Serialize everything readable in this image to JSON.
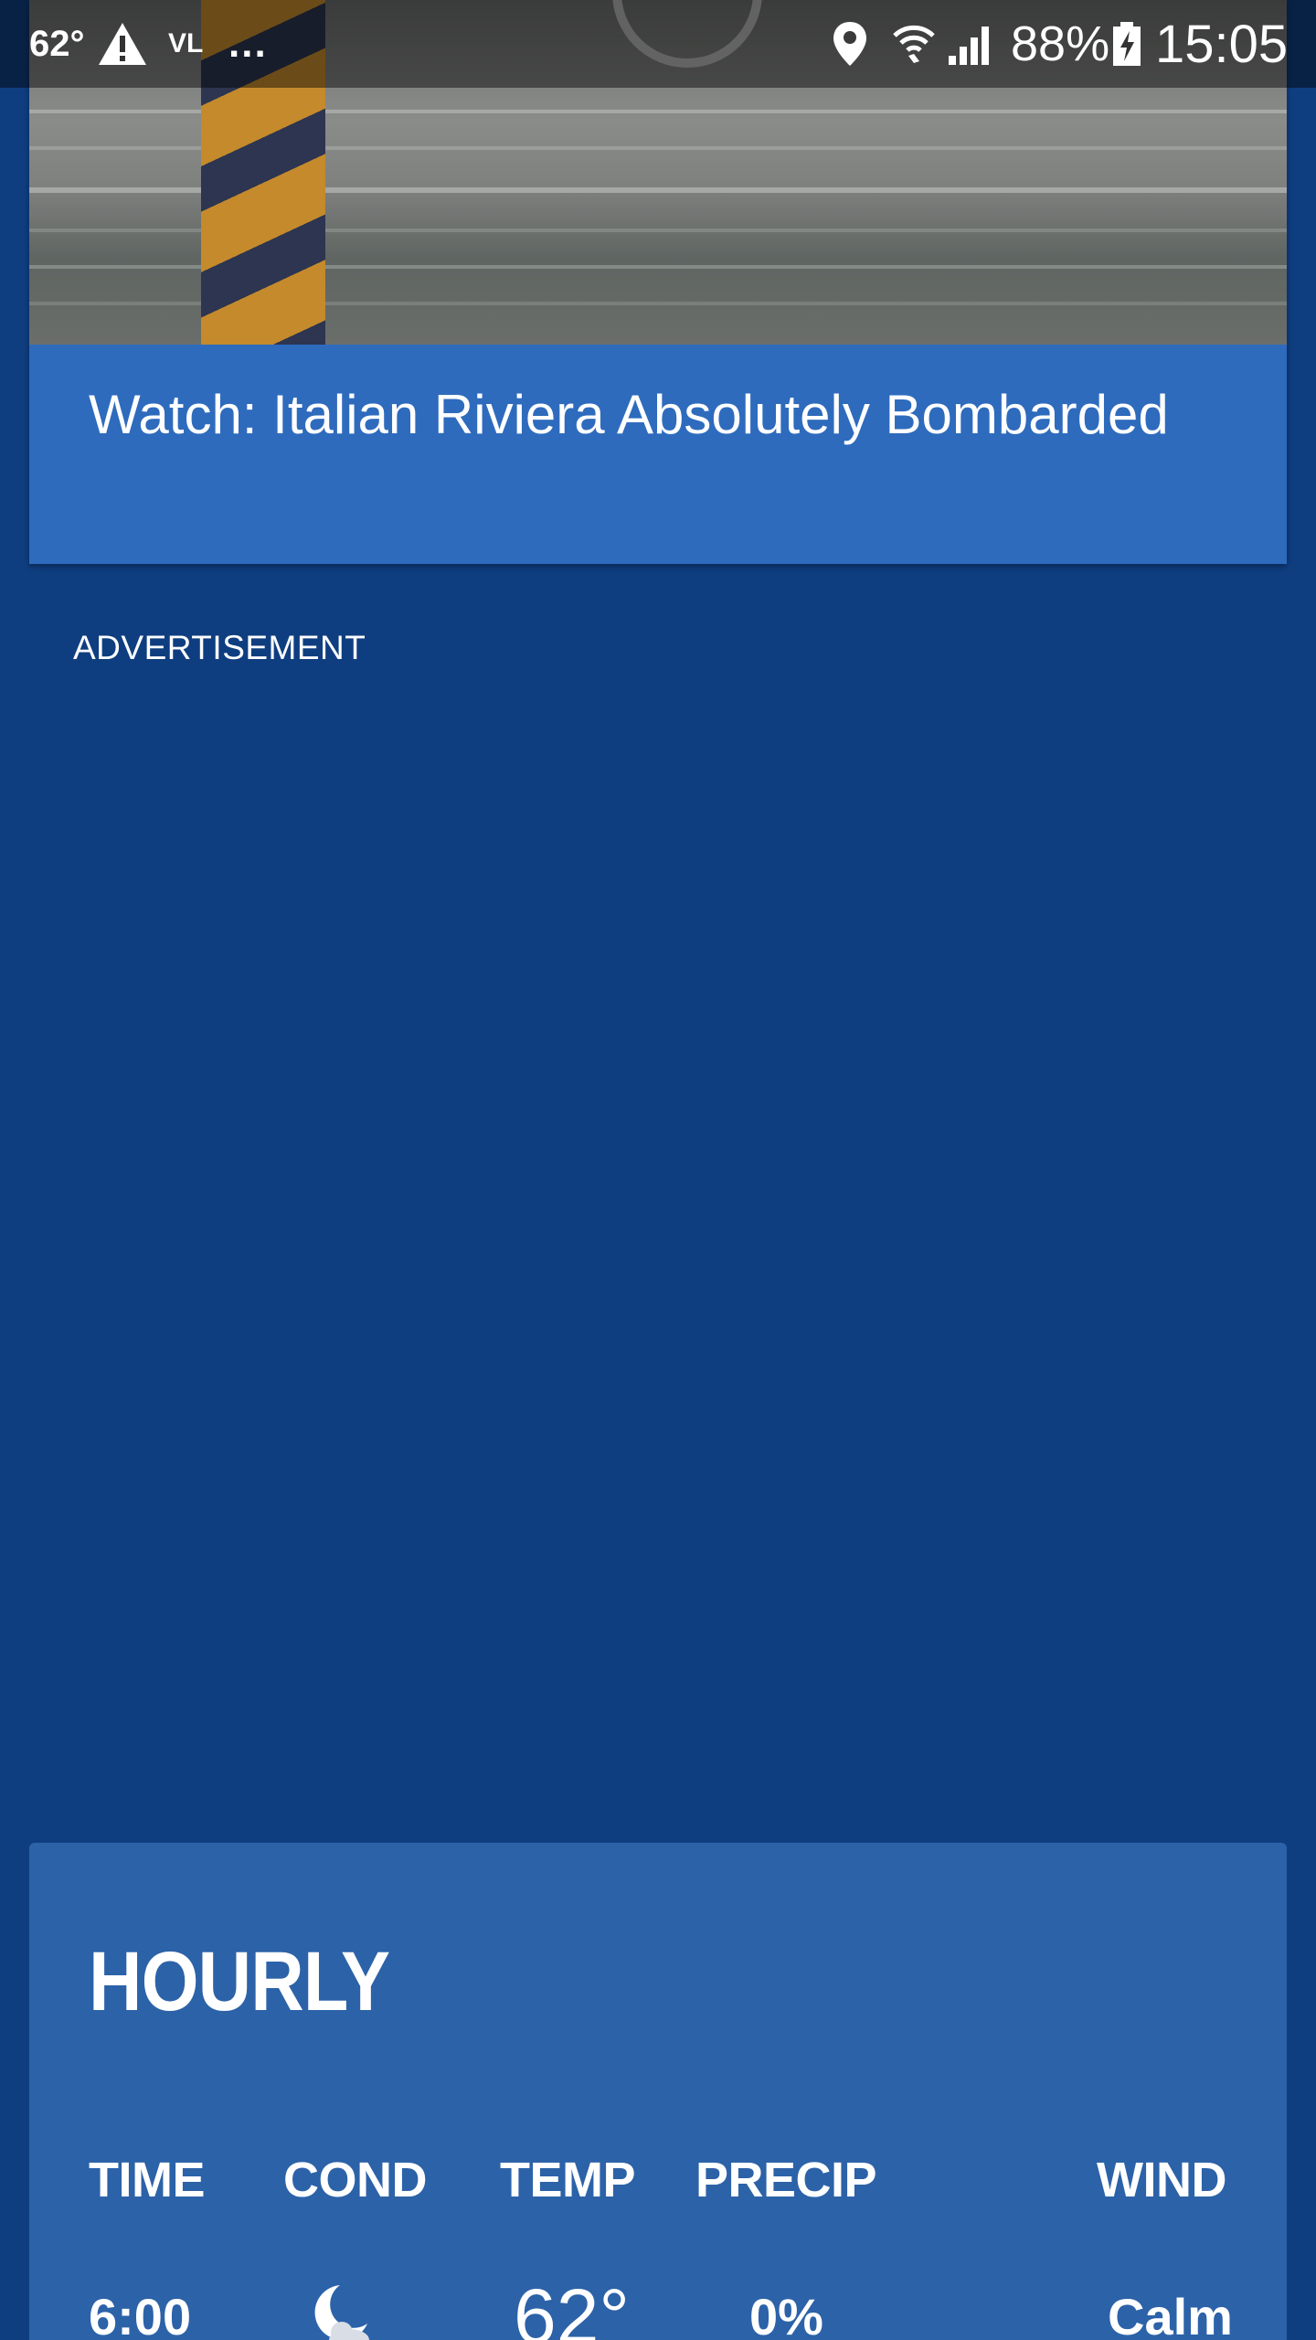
{
  "status_bar": {
    "temperature": "62°",
    "carrier": "VL",
    "more": "...",
    "battery_percent": "88%",
    "time": "15:05"
  },
  "video": {
    "title": "Watch: Italian Riviera Absolutely Bombarded"
  },
  "advertisement_label": "ADVERTISEMENT",
  "hourly": {
    "title": "HOURLY",
    "headers": {
      "time": "TIME",
      "cond": "COND",
      "temp": "TEMP",
      "precip": "PRECIP",
      "wind": "WIND"
    },
    "rows": [
      {
        "time": "6:00",
        "cond_icon": "partly-cloudy-night-icon",
        "temp": "62°",
        "precip": "0%",
        "wind": "Calm"
      }
    ]
  }
}
